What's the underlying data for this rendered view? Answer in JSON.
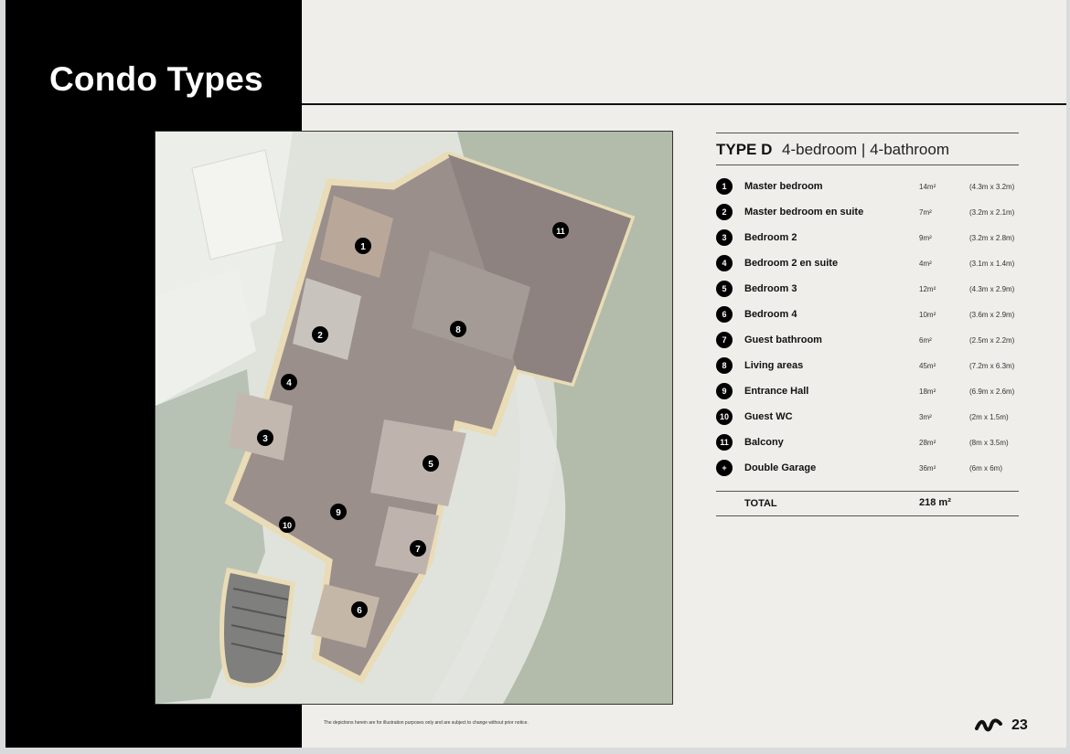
{
  "page": {
    "title": "Condo Types",
    "page_number": "23",
    "disclaimer": "The depictions herein are for illustration purposes only and are subject to change without prior notice.",
    "logo": "brand-logo-icon"
  },
  "type": {
    "name": "TYPE D",
    "description": "4-bedroom | 4-bathroom"
  },
  "rooms": [
    {
      "num": "1",
      "name": "Master bedroom",
      "area": "14m²",
      "dims": "(4.3m x 3.2m)"
    },
    {
      "num": "2",
      "name": "Master bedroom en suite",
      "area": "7m²",
      "dims": "(3.2m x 2.1m)"
    },
    {
      "num": "3",
      "name": "Bedroom 2",
      "area": "9m²",
      "dims": "(3.2m x 2.8m)"
    },
    {
      "num": "4",
      "name": "Bedroom 2 en suite",
      "area": "4m²",
      "dims": "(3.1m x 1.4m)"
    },
    {
      "num": "5",
      "name": "Bedroom 3",
      "area": "12m²",
      "dims": "(4.3m x 2.9m)"
    },
    {
      "num": "6",
      "name": "Bedroom 4",
      "area": "10m²",
      "dims": "(3.6m x 2.9m)"
    },
    {
      "num": "7",
      "name": "Guest bathroom",
      "area": "6m²",
      "dims": "(2.5m x 2.2m)"
    },
    {
      "num": "8",
      "name": "Living areas",
      "area": "45m²",
      "dims": "(7.2m x 6.3m)"
    },
    {
      "num": "9",
      "name": "Entrance Hall",
      "area": "18m²",
      "dims": "(6.9m x 2.6m)"
    },
    {
      "num": "10",
      "name": "Guest WC",
      "area": "3m²",
      "dims": "(2m x 1.5m)"
    },
    {
      "num": "11",
      "name": "Balcony",
      "area": "28m²",
      "dims": "(8m x 3.5m)"
    },
    {
      "num": "+",
      "name": "Double Garage",
      "area": "36m²",
      "dims": "(6m x 6m)"
    }
  ],
  "total": {
    "label": "TOTAL",
    "value": "218 m²"
  },
  "plan_markers": [
    "1",
    "2",
    "3",
    "4",
    "5",
    "6",
    "7",
    "8",
    "9",
    "10",
    "11"
  ]
}
